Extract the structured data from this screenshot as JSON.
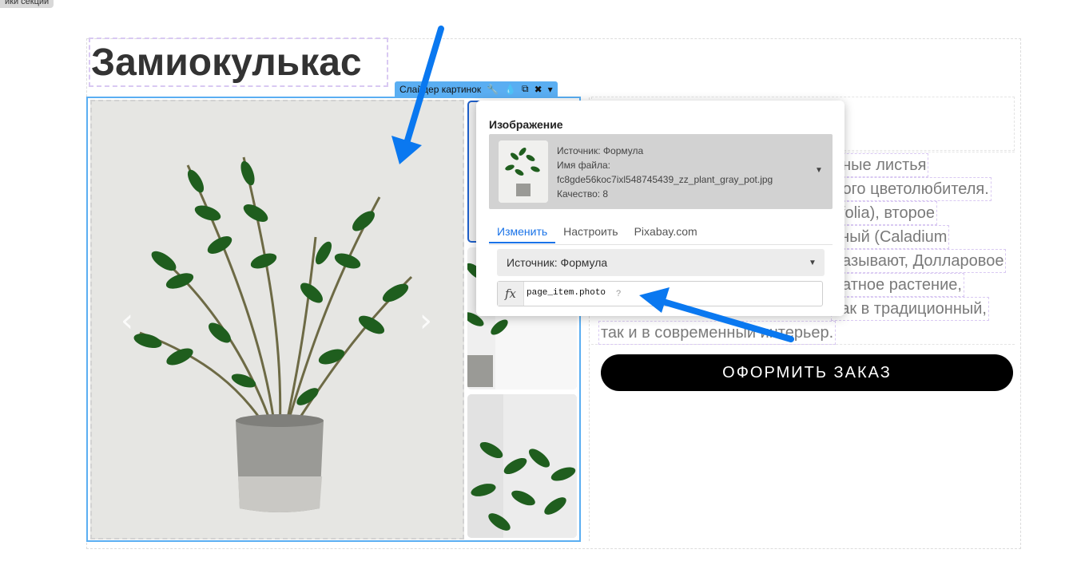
{
  "section_settings_tag": "йки секции",
  "product": {
    "title": "Замиокулькас",
    "description_lines": [
      "еные листья",
      "бого цветолюбителя.",
      "iifolia), второе",
      "тный (Caladium",
      "называют, Долларовое",
      "натное растение,",
      "как в традиционный,",
      "так и в современный интерьер."
    ],
    "order_button": "ОФОРМИТЬ ЗАКАЗ"
  },
  "slider": {
    "prev_arrow": "‹",
    "next_arrow": "›"
  },
  "toolbar": {
    "label": "Слайдер картинок",
    "icons": [
      "wrench-icon",
      "drop-icon",
      "duplicate-icon",
      "close-icon",
      "dropdown-icon"
    ],
    "glyphs": [
      "🔧",
      "💧",
      "⧉",
      "✖",
      "▾"
    ]
  },
  "image_popup": {
    "heading": "Изображение",
    "meta": {
      "source": "Источник: Формула",
      "filename_label": "Имя файла:",
      "filename": "fc8gde56koc7ixl548745439_zz_plant_gray_pot.jpg",
      "quality": "Качество: 8"
    },
    "tabs": [
      "Изменить",
      "Настроить",
      "Pixabay.com"
    ],
    "active_tab": 0,
    "source_select": "Источник: Формула",
    "formula": {
      "icon": "fx",
      "value": "page_item.photo",
      "help": "?"
    }
  },
  "colors": {
    "accent": "#1a73e8",
    "toolbar": "#5aaef2",
    "annotation_arrow": "#0a78f0",
    "button_bg": "#000000"
  }
}
